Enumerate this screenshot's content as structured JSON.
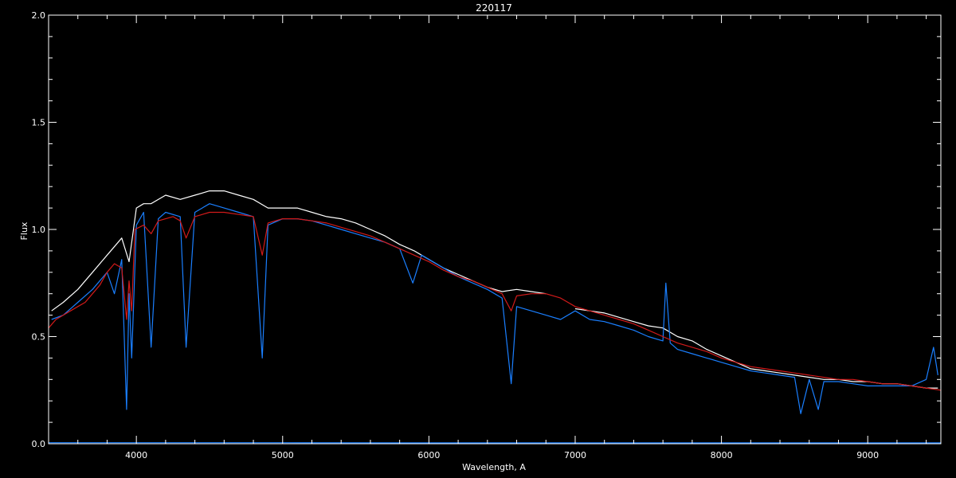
{
  "chart_data": {
    "type": "line",
    "title": "220117",
    "xlabel": "Wavelength, A",
    "ylabel": "Flux",
    "xlim": [
      3400,
      9500
    ],
    "ylim": [
      0.0,
      2.0
    ],
    "xticks": [
      4000,
      5000,
      6000,
      7000,
      8000,
      9000
    ],
    "xtick_labels": [
      "4000",
      "5000",
      "6000",
      "7000",
      "8000",
      "9000"
    ],
    "yticks": [
      0.0,
      0.5,
      1.0,
      1.5,
      2.0
    ],
    "ytick_labels": [
      "0.0",
      "0.5",
      "1.0",
      "1.5",
      "2.0"
    ],
    "grid": false,
    "background": "#000000",
    "series": [
      {
        "color": "#ffffff",
        "x": [
          3420,
          3500,
          3600,
          3700,
          3800,
          3900,
          3950,
          4000,
          4050,
          4100,
          4200,
          4300,
          4400,
          4500,
          4600,
          4700,
          4800,
          4900,
          5000,
          5100,
          5200,
          5300,
          5400,
          5500,
          5600,
          5700,
          5800,
          5900,
          6000,
          6100,
          6200,
          6300,
          6400,
          6500,
          6600,
          6700,
          6800,
          6950,
          7000,
          7100,
          7200,
          7300,
          7400,
          7500,
          7600,
          7700,
          7800,
          7900,
          8000,
          8100,
          8200,
          8300,
          8400,
          8500,
          8600,
          8700,
          8800,
          8900,
          9000,
          9100,
          9200,
          9300,
          9400,
          9480
        ],
        "y": [
          0.62,
          0.66,
          0.72,
          0.8,
          0.88,
          0.96,
          0.85,
          1.1,
          1.12,
          1.12,
          1.16,
          1.14,
          1.16,
          1.18,
          1.18,
          1.16,
          1.14,
          1.1,
          1.1,
          1.1,
          1.08,
          1.06,
          1.05,
          1.03,
          1.0,
          0.97,
          0.93,
          0.9,
          0.86,
          0.82,
          0.79,
          0.76,
          0.73,
          0.71,
          0.72,
          0.71,
          0.7,
          null,
          0.63,
          0.62,
          0.61,
          0.59,
          0.57,
          0.55,
          0.54,
          0.5,
          0.48,
          0.44,
          0.41,
          0.38,
          0.35,
          0.34,
          0.33,
          0.32,
          0.31,
          0.3,
          0.3,
          0.29,
          0.29,
          0.28,
          0.28,
          0.27,
          0.26,
          0.26
        ]
      },
      {
        "color": "#1a7fff",
        "x": [
          3420,
          3500,
          3600,
          3700,
          3800,
          3850,
          3900,
          3933,
          3950,
          3968,
          4000,
          4050,
          4101,
          4150,
          4200,
          4300,
          4340,
          4400,
          4500,
          4600,
          4700,
          4800,
          4861,
          4900,
          5000,
          5100,
          5200,
          5300,
          5400,
          5500,
          5600,
          5700,
          5800,
          5890,
          5950,
          6000,
          6100,
          6200,
          6300,
          6400,
          6500,
          6563,
          6600,
          6700,
          6800,
          6900,
          7000,
          7100,
          7200,
          7300,
          7400,
          7500,
          7600,
          7620,
          7650,
          7700,
          7800,
          7900,
          8000,
          8100,
          8200,
          8300,
          8400,
          8500,
          8542,
          8600,
          8662,
          8700,
          8800,
          8900,
          9000,
          9100,
          9200,
          9300,
          9400,
          9450,
          9480
        ],
        "y": [
          0.58,
          0.6,
          0.66,
          0.72,
          0.8,
          0.7,
          0.86,
          0.16,
          0.7,
          0.4,
          1.02,
          1.08,
          0.45,
          1.05,
          1.08,
          1.06,
          0.45,
          1.08,
          1.12,
          1.1,
          1.08,
          1.06,
          0.4,
          1.02,
          1.05,
          1.05,
          1.04,
          1.02,
          1.0,
          0.98,
          0.96,
          0.94,
          0.91,
          0.75,
          0.88,
          0.86,
          0.82,
          0.78,
          0.75,
          0.72,
          0.68,
          0.28,
          0.64,
          0.62,
          0.6,
          0.58,
          0.62,
          0.58,
          0.57,
          0.55,
          0.53,
          0.5,
          0.48,
          0.75,
          0.47,
          0.44,
          0.42,
          0.4,
          0.38,
          0.36,
          0.34,
          0.33,
          0.32,
          0.31,
          0.14,
          0.3,
          0.16,
          0.29,
          0.29,
          0.28,
          0.27,
          0.27,
          0.27,
          0.27,
          0.3,
          0.45,
          0.32
        ]
      },
      {
        "color": "#d21a1a",
        "x": [
          3400,
          3450,
          3500,
          3550,
          3600,
          3650,
          3700,
          3750,
          3800,
          3850,
          3900,
          3933,
          3950,
          3968,
          3990,
          4050,
          4101,
          4150,
          4200,
          4250,
          4300,
          4340,
          4400,
          4500,
          4600,
          4700,
          4800,
          4861,
          4900,
          5000,
          5100,
          5200,
          5300,
          5400,
          5500,
          5600,
          5700,
          5800,
          5900,
          6000,
          6100,
          6200,
          6300,
          6400,
          6500,
          6563,
          6600,
          6700,
          6800,
          6900,
          7000,
          7100,
          7200,
          7300,
          7400,
          7500,
          7600,
          7700,
          7800,
          7900,
          8000,
          8100,
          8200,
          8300,
          8400,
          8500,
          8600,
          8700,
          8800,
          8900,
          9000,
          9100,
          9200,
          9300,
          9400,
          9500
        ],
        "y": [
          0.54,
          0.58,
          0.6,
          0.62,
          0.64,
          0.66,
          0.7,
          0.74,
          0.8,
          0.84,
          0.82,
          0.58,
          0.76,
          0.62,
          1.0,
          1.02,
          0.98,
          1.04,
          1.05,
          1.06,
          1.04,
          0.96,
          1.06,
          1.08,
          1.08,
          1.07,
          1.06,
          0.88,
          1.03,
          1.05,
          1.05,
          1.04,
          1.03,
          1.01,
          0.99,
          0.97,
          0.94,
          0.91,
          0.88,
          0.85,
          0.81,
          0.78,
          0.76,
          0.73,
          0.7,
          0.62,
          0.69,
          0.7,
          0.7,
          0.68,
          0.64,
          0.62,
          0.6,
          0.58,
          0.56,
          0.53,
          0.5,
          0.47,
          0.45,
          0.43,
          0.4,
          0.38,
          0.36,
          0.35,
          0.34,
          0.33,
          0.32,
          0.31,
          0.3,
          0.3,
          0.29,
          0.28,
          0.28,
          0.27,
          0.26,
          0.25
        ]
      },
      {
        "color": "#1a7fff",
        "x": [
          3400,
          4000,
          5000,
          6000,
          6500,
          7000,
          8000,
          9000,
          9500
        ],
        "y": [
          0.005,
          0.005,
          0.005,
          0.004,
          0.004,
          0.004,
          0.004,
          0.004,
          0.004
        ]
      }
    ]
  }
}
